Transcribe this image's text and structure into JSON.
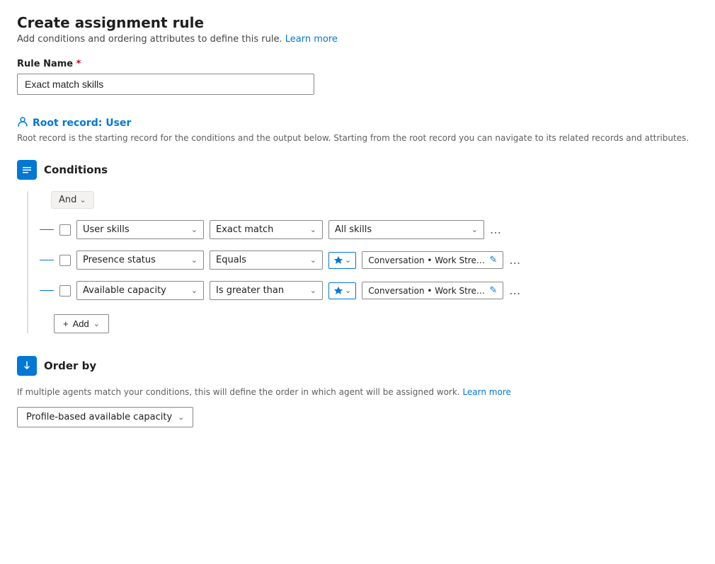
{
  "page": {
    "title": "Create assignment rule",
    "subtitle": "Add conditions and ordering attributes to define this rule.",
    "learn_more_label": "Learn more",
    "rule_name_label": "Rule Name",
    "required_marker": "*",
    "rule_name_value": "Exact match skills",
    "root_record_label": "Root record: User",
    "root_record_desc": "Root record is the starting record for the conditions and the output below. Starting from the root record you can navigate to its related records and attributes."
  },
  "conditions": {
    "section_title": "Conditions",
    "and_label": "And",
    "rows": [
      {
        "id": "row1",
        "field": "User skills",
        "operator": "Exact match",
        "value_type": "static",
        "value": "All skills"
      },
      {
        "id": "row2",
        "field": "Presence status",
        "operator": "Equals",
        "value_type": "dynamic",
        "value": "Conversation • Work Stream • All..."
      },
      {
        "id": "row3",
        "field": "Available capacity",
        "operator": "Is greater than",
        "value_type": "dynamic",
        "value": "Conversation • Work Stream • Ca..."
      }
    ],
    "add_label": "Add"
  },
  "order_by": {
    "section_title": "Order by",
    "desc": "If multiple agents match your conditions, this will define the order in which agent will be assigned work.",
    "learn_more_label": "Learn more",
    "dropdown_value": "Profile-based available capacity"
  }
}
